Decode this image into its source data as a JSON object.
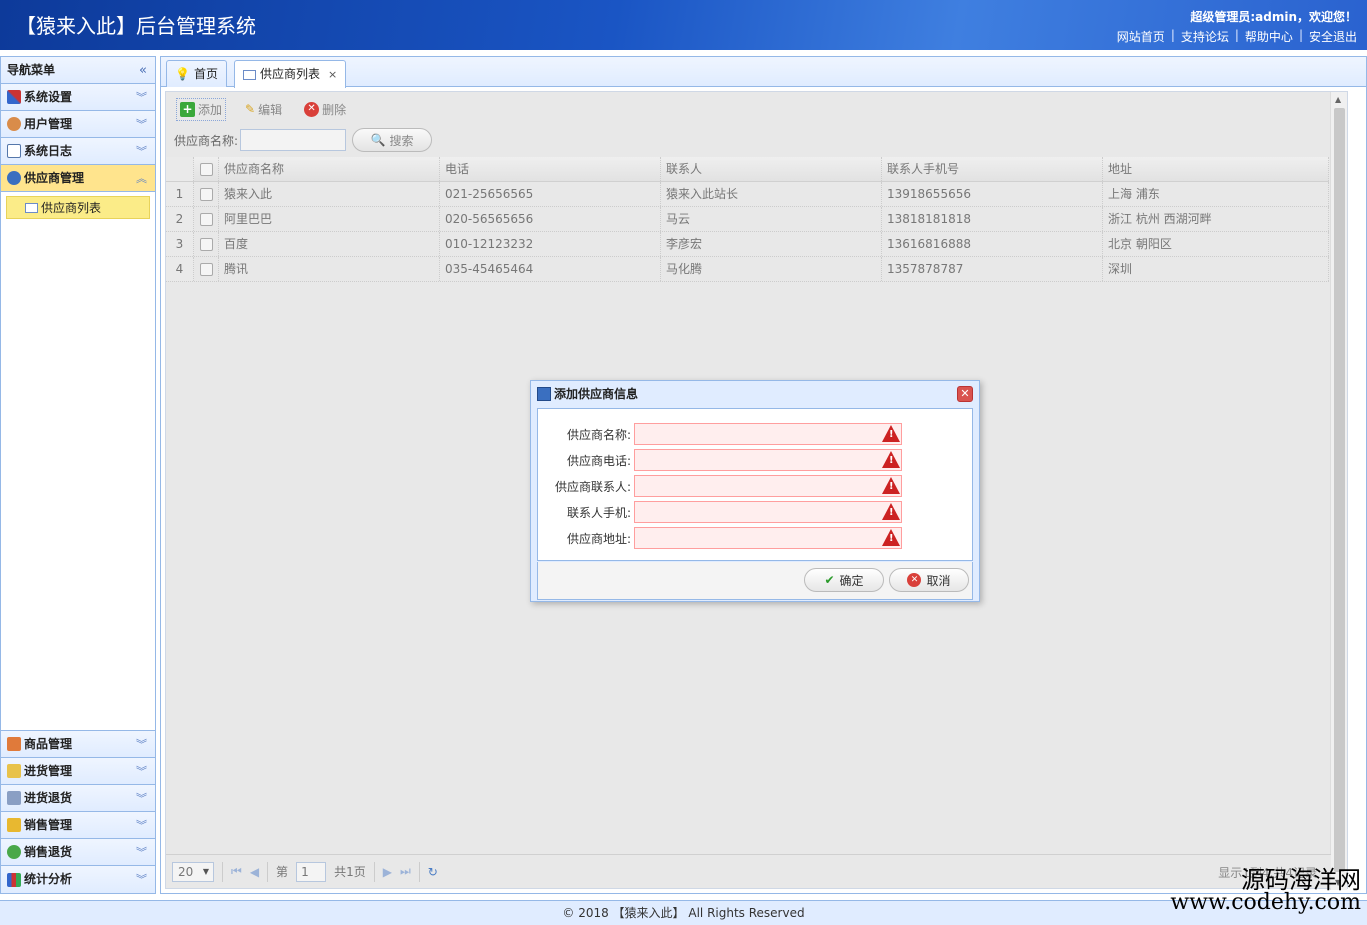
{
  "header": {
    "title": "【猿来入此】后台管理系统",
    "welcome": "超级管理员:admin，欢迎您！",
    "links": [
      "网站首页",
      "支持论坛",
      "帮助中心",
      "安全退出"
    ]
  },
  "sidebar": {
    "title": "导航菜单",
    "groups": [
      {
        "label": "系统设置"
      },
      {
        "label": "用户管理"
      },
      {
        "label": "系统日志"
      },
      {
        "label": "供应商管理",
        "active": true,
        "items": [
          "供应商列表"
        ]
      }
    ],
    "bottom_groups": [
      {
        "label": "商品管理"
      },
      {
        "label": "进货管理"
      },
      {
        "label": "进货退货"
      },
      {
        "label": "销售管理"
      },
      {
        "label": "销售退货"
      },
      {
        "label": "统计分析"
      }
    ]
  },
  "tabs": [
    {
      "label": "首页"
    },
    {
      "label": "供应商列表",
      "active": true,
      "close": "×"
    }
  ],
  "toolbar": {
    "add": "添加",
    "edit": "编辑",
    "delete": "删除"
  },
  "search": {
    "label": "供应商名称:",
    "value": "",
    "button": "搜索"
  },
  "grid": {
    "columns": [
      "供应商名称",
      "电话",
      "联系人",
      "联系人手机号",
      "地址"
    ],
    "rows": [
      {
        "num": "1",
        "name": "猿来入此",
        "tel": "021-25656565",
        "contact": "猿来入此站长",
        "mobile": "13918655656",
        "addr": "上海 浦东"
      },
      {
        "num": "2",
        "name": "阿里巴巴",
        "tel": "020-56565656",
        "contact": "马云",
        "mobile": "13818181818",
        "addr": "浙江 杭州 西湖河畔"
      },
      {
        "num": "3",
        "name": "百度",
        "tel": "010-12123232",
        "contact": "李彦宏",
        "mobile": "13616816888",
        "addr": "北京 朝阳区"
      },
      {
        "num": "4",
        "name": "腾讯",
        "tel": "035-45465464",
        "contact": "马化腾",
        "mobile": "1357878787",
        "addr": "深圳"
      }
    ]
  },
  "pager": {
    "page_size": "20",
    "page_prefix": "第",
    "page": "1",
    "total_pages": "共1页",
    "info": "显示1到4,共4记录"
  },
  "dialog": {
    "title": "添加供应商信息",
    "fields": [
      {
        "label": "供应商名称:",
        "value": ""
      },
      {
        "label": "供应商电话:",
        "value": ""
      },
      {
        "label": "供应商联系人:",
        "value": ""
      },
      {
        "label": "联系人手机:",
        "value": ""
      },
      {
        "label": "供应商地址:",
        "value": ""
      }
    ],
    "ok": "确定",
    "cancel": "取消"
  },
  "footer": {
    "text": "© 2018 【猿来入此】 All Rights Reserved"
  },
  "watermark": {
    "line1": "源码海洋网",
    "line2": "www.codehy.com"
  },
  "colors": {
    "header_blue": "#1a55c4",
    "border_blue": "#95b8e7",
    "active_yellow": "#ffe48d",
    "error_red": "#cc2222"
  }
}
